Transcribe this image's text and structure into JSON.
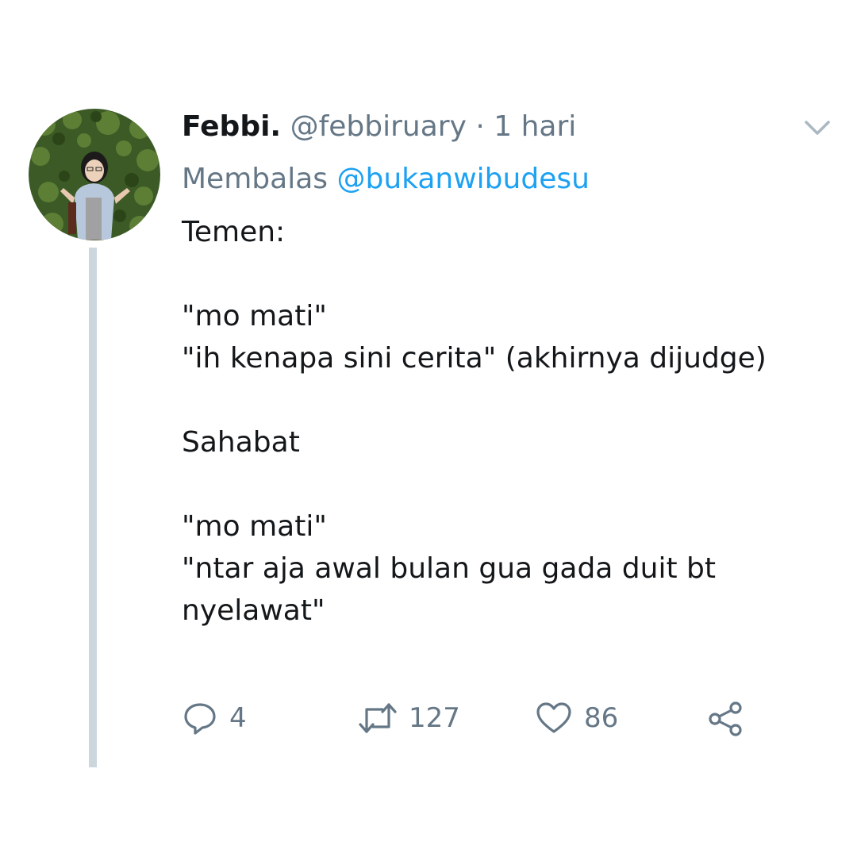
{
  "tweet": {
    "author_name": "Febbi.",
    "author_handle": "@febbiruary",
    "separator": "·",
    "time": "1 hari",
    "replying_prefix": "Membalas",
    "replying_to": "@bukanwibudesu",
    "text_blocks": [
      "Temen:",
      "",
      "\"mo mati\"",
      "\"ih kenapa sini cerita\" (akhirnya dijudge)",
      "",
      "Sahabat",
      "",
      "\"mo mati\"",
      "\"ntar aja awal bulan gua gada duit bt nyelawat\""
    ],
    "reply_count": "4",
    "retweet_count": "127",
    "like_count": "86"
  },
  "icons": {
    "caret": "chevron-down-icon",
    "reply": "reply-icon",
    "retweet": "retweet-icon",
    "like": "heart-icon",
    "share": "share-icon"
  },
  "colors": {
    "text": "#14171a",
    "secondary": "#657786",
    "link": "#1da1f2",
    "thread_line": "#ccd6dd"
  }
}
